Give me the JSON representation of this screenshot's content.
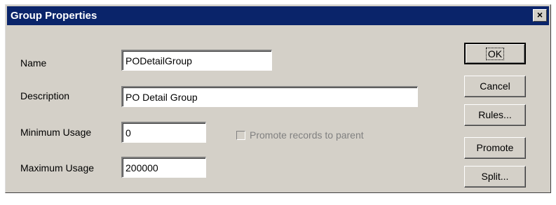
{
  "dialog": {
    "title": "Group Properties",
    "close_label": "×"
  },
  "form": {
    "name_label": "Name",
    "name_value": "PODetailGroup",
    "description_label": "Description",
    "description_value": "PO Detail Group",
    "min_usage_label": "Minimum Usage",
    "min_usage_value": "0",
    "max_usage_label": "Maximum Usage",
    "max_usage_value": "200000",
    "promote_checkbox_label": "Promote records to parent",
    "promote_checked": false
  },
  "buttons": {
    "ok": "OK",
    "cancel": "Cancel",
    "rules": "Rules...",
    "promote": "Promote",
    "split": "Split..."
  }
}
